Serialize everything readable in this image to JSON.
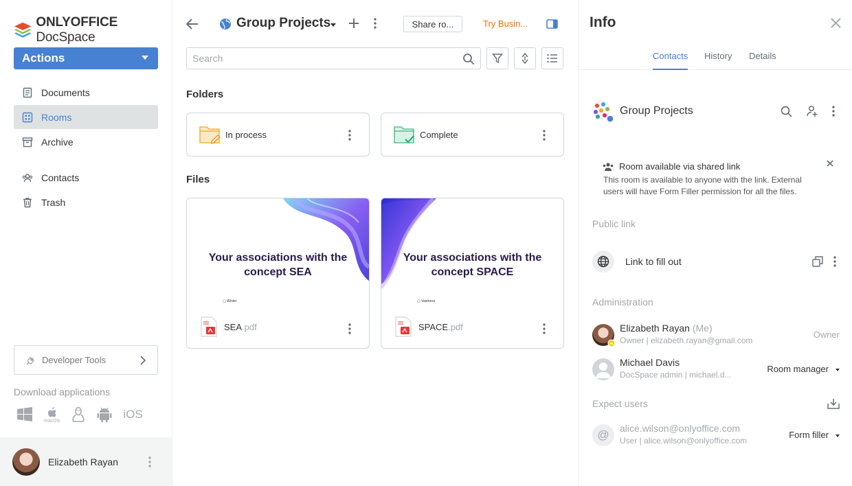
{
  "app": {
    "brand_bold": "ONLYOFFICE",
    "brand_regular": " DocSpace",
    "actions_label": "Actions"
  },
  "sidebar": {
    "items": [
      {
        "label": "Documents"
      },
      {
        "label": "Rooms"
      },
      {
        "label": "Archive"
      },
      {
        "label": "Contacts"
      },
      {
        "label": "Trash"
      }
    ],
    "dev_tools": "Developer Tools",
    "download_label": "Download applications",
    "ios_label": "iOS",
    "macos_label": "macOS",
    "user_name": "Elizabeth Rayan"
  },
  "header": {
    "title": "Group Projects",
    "share_button": "Share ro...",
    "try_business": "Try Busin..."
  },
  "search": {
    "placeholder": "Search"
  },
  "folders": {
    "title": "Folders",
    "items": [
      {
        "name": "In process"
      },
      {
        "name": "Complete"
      }
    ]
  },
  "files": {
    "title": "Files",
    "items": [
      {
        "thumb_text": "Your associations with the concept SEA",
        "thumb_mini": "Winter",
        "name": "SEA",
        "ext": ".pdf"
      },
      {
        "thumb_text": "Your associations with the concept SPACE",
        "thumb_mini": "Vastness",
        "name": "SPACE",
        "ext": ".pdf"
      }
    ]
  },
  "info": {
    "title": "Info",
    "tabs": [
      {
        "label": "Contacts"
      },
      {
        "label": "History"
      },
      {
        "label": "Details"
      }
    ],
    "room_name": "Group Projects",
    "notice_title": "Room available via shared link",
    "notice_text": "This room is available to anyone with the link. External users will have Form Filler permission for all the files.",
    "public_link_label": "Public link",
    "link_name": "Link to fill out",
    "administration_label": "Administration",
    "users": [
      {
        "name": "Elizabeth Rayan",
        "me": " (Me)",
        "sub": "Owner | elizabeth.rayan@gmail.com",
        "role": "Owner"
      },
      {
        "name": "Michael Davis",
        "sub": "DocSpace admin | michael.d...",
        "role": "Room manager"
      }
    ],
    "expect_label": "Expect users",
    "expect_user": {
      "name": "alice.wilson@onlyoffice.com",
      "sub": "User | alice.wilson@onlyoffice.com",
      "role": "Form filler"
    }
  },
  "colors": {
    "accent": "#4781d1",
    "try_business": "#ed7309",
    "border": "#d0d5da"
  }
}
